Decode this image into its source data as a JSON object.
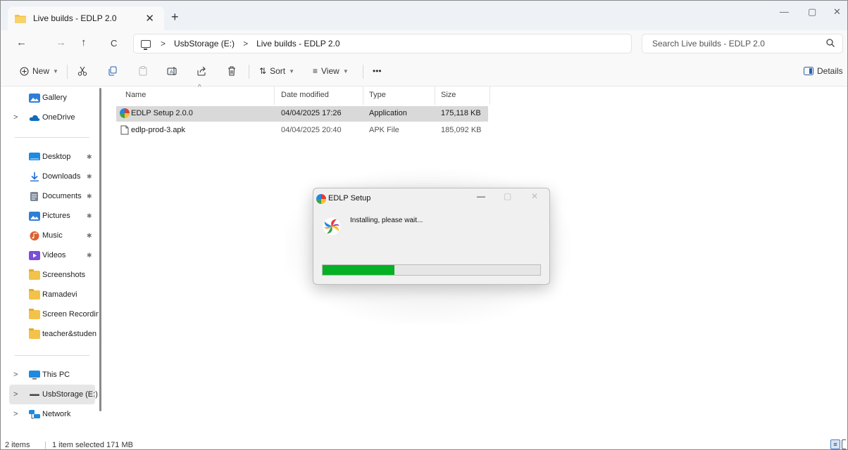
{
  "window": {
    "tab_title": "Live builds - EDLP 2.0",
    "tab_close": "✕",
    "new_tab": "+",
    "controls": {
      "minimize": "—",
      "maximize": "▢",
      "close": "✕"
    }
  },
  "navigation": {
    "back": "←",
    "forward": "→",
    "up": "↑",
    "refresh": "C",
    "breadcrumb": [
      "UsbStorage (E:)",
      "Live builds - EDLP 2.0"
    ],
    "breadcrumb_sep": ">",
    "search_placeholder": "Search Live builds - EDLP 2.0"
  },
  "toolbar": {
    "new_label": "New",
    "sort_label": "Sort",
    "view_label": "View",
    "more_label": "•••",
    "details_label": "Details"
  },
  "sidebar": {
    "items": [
      {
        "label": "Gallery",
        "icon": "gallery-icon",
        "color": "#2d7fd6"
      },
      {
        "label": "OneDrive",
        "icon": "cloud-icon",
        "color": "#0f6cbd"
      },
      {
        "label": "Desktop",
        "icon": "desktop-icon",
        "color": "#1d8ae0"
      },
      {
        "label": "Downloads",
        "icon": "download-icon",
        "color": "#1d6fd0"
      },
      {
        "label": "Documents",
        "icon": "document-icon",
        "color": "#7b8796"
      },
      {
        "label": "Pictures",
        "icon": "pictures-icon",
        "color": "#2d7fd6"
      },
      {
        "label": "Music",
        "icon": "music-icon",
        "color": "#e0602b"
      },
      {
        "label": "Videos",
        "icon": "videos-icon",
        "color": "#7b4fd8"
      },
      {
        "label": "Screenshots",
        "icon": "folder-icon",
        "color": "#f3c24a"
      },
      {
        "label": "Ramadevi",
        "icon": "folder-icon",
        "color": "#f3c24a"
      },
      {
        "label": "Screen Recordin",
        "icon": "folder-icon",
        "color": "#f3c24a"
      },
      {
        "label": "teacher&studen",
        "icon": "folder-icon",
        "color": "#f3c24a"
      },
      {
        "label": "This PC",
        "icon": "pc-icon",
        "color": "#1d8ae0"
      },
      {
        "label": "UsbStorage (E:)",
        "icon": "drive-icon",
        "color": "#444444"
      },
      {
        "label": "Network",
        "icon": "network-icon",
        "color": "#1d8ae0"
      }
    ],
    "chevron": ">",
    "pin": "✱"
  },
  "filelist": {
    "columns": [
      "Name",
      "Date modified",
      "Type",
      "Size"
    ],
    "sort_arrow": "^",
    "rows": [
      {
        "name": "EDLP Setup 2.0.0",
        "date": "04/04/2025 17:26",
        "type": "Application",
        "size": "175,118 KB"
      },
      {
        "name": "edlp-prod-3.apk",
        "date": "04/04/2025 20:40",
        "type": "APK File",
        "size": "185,092 KB"
      }
    ]
  },
  "dialog": {
    "title": "EDLP Setup",
    "message": "Installing, please wait...",
    "progress": 0.33,
    "controls": {
      "minimize": "—",
      "maximize": "▢",
      "close": "✕"
    },
    "progress_color": "#06b025"
  },
  "status": {
    "count": "2 items",
    "selection": "1 item selected  171 MB"
  }
}
